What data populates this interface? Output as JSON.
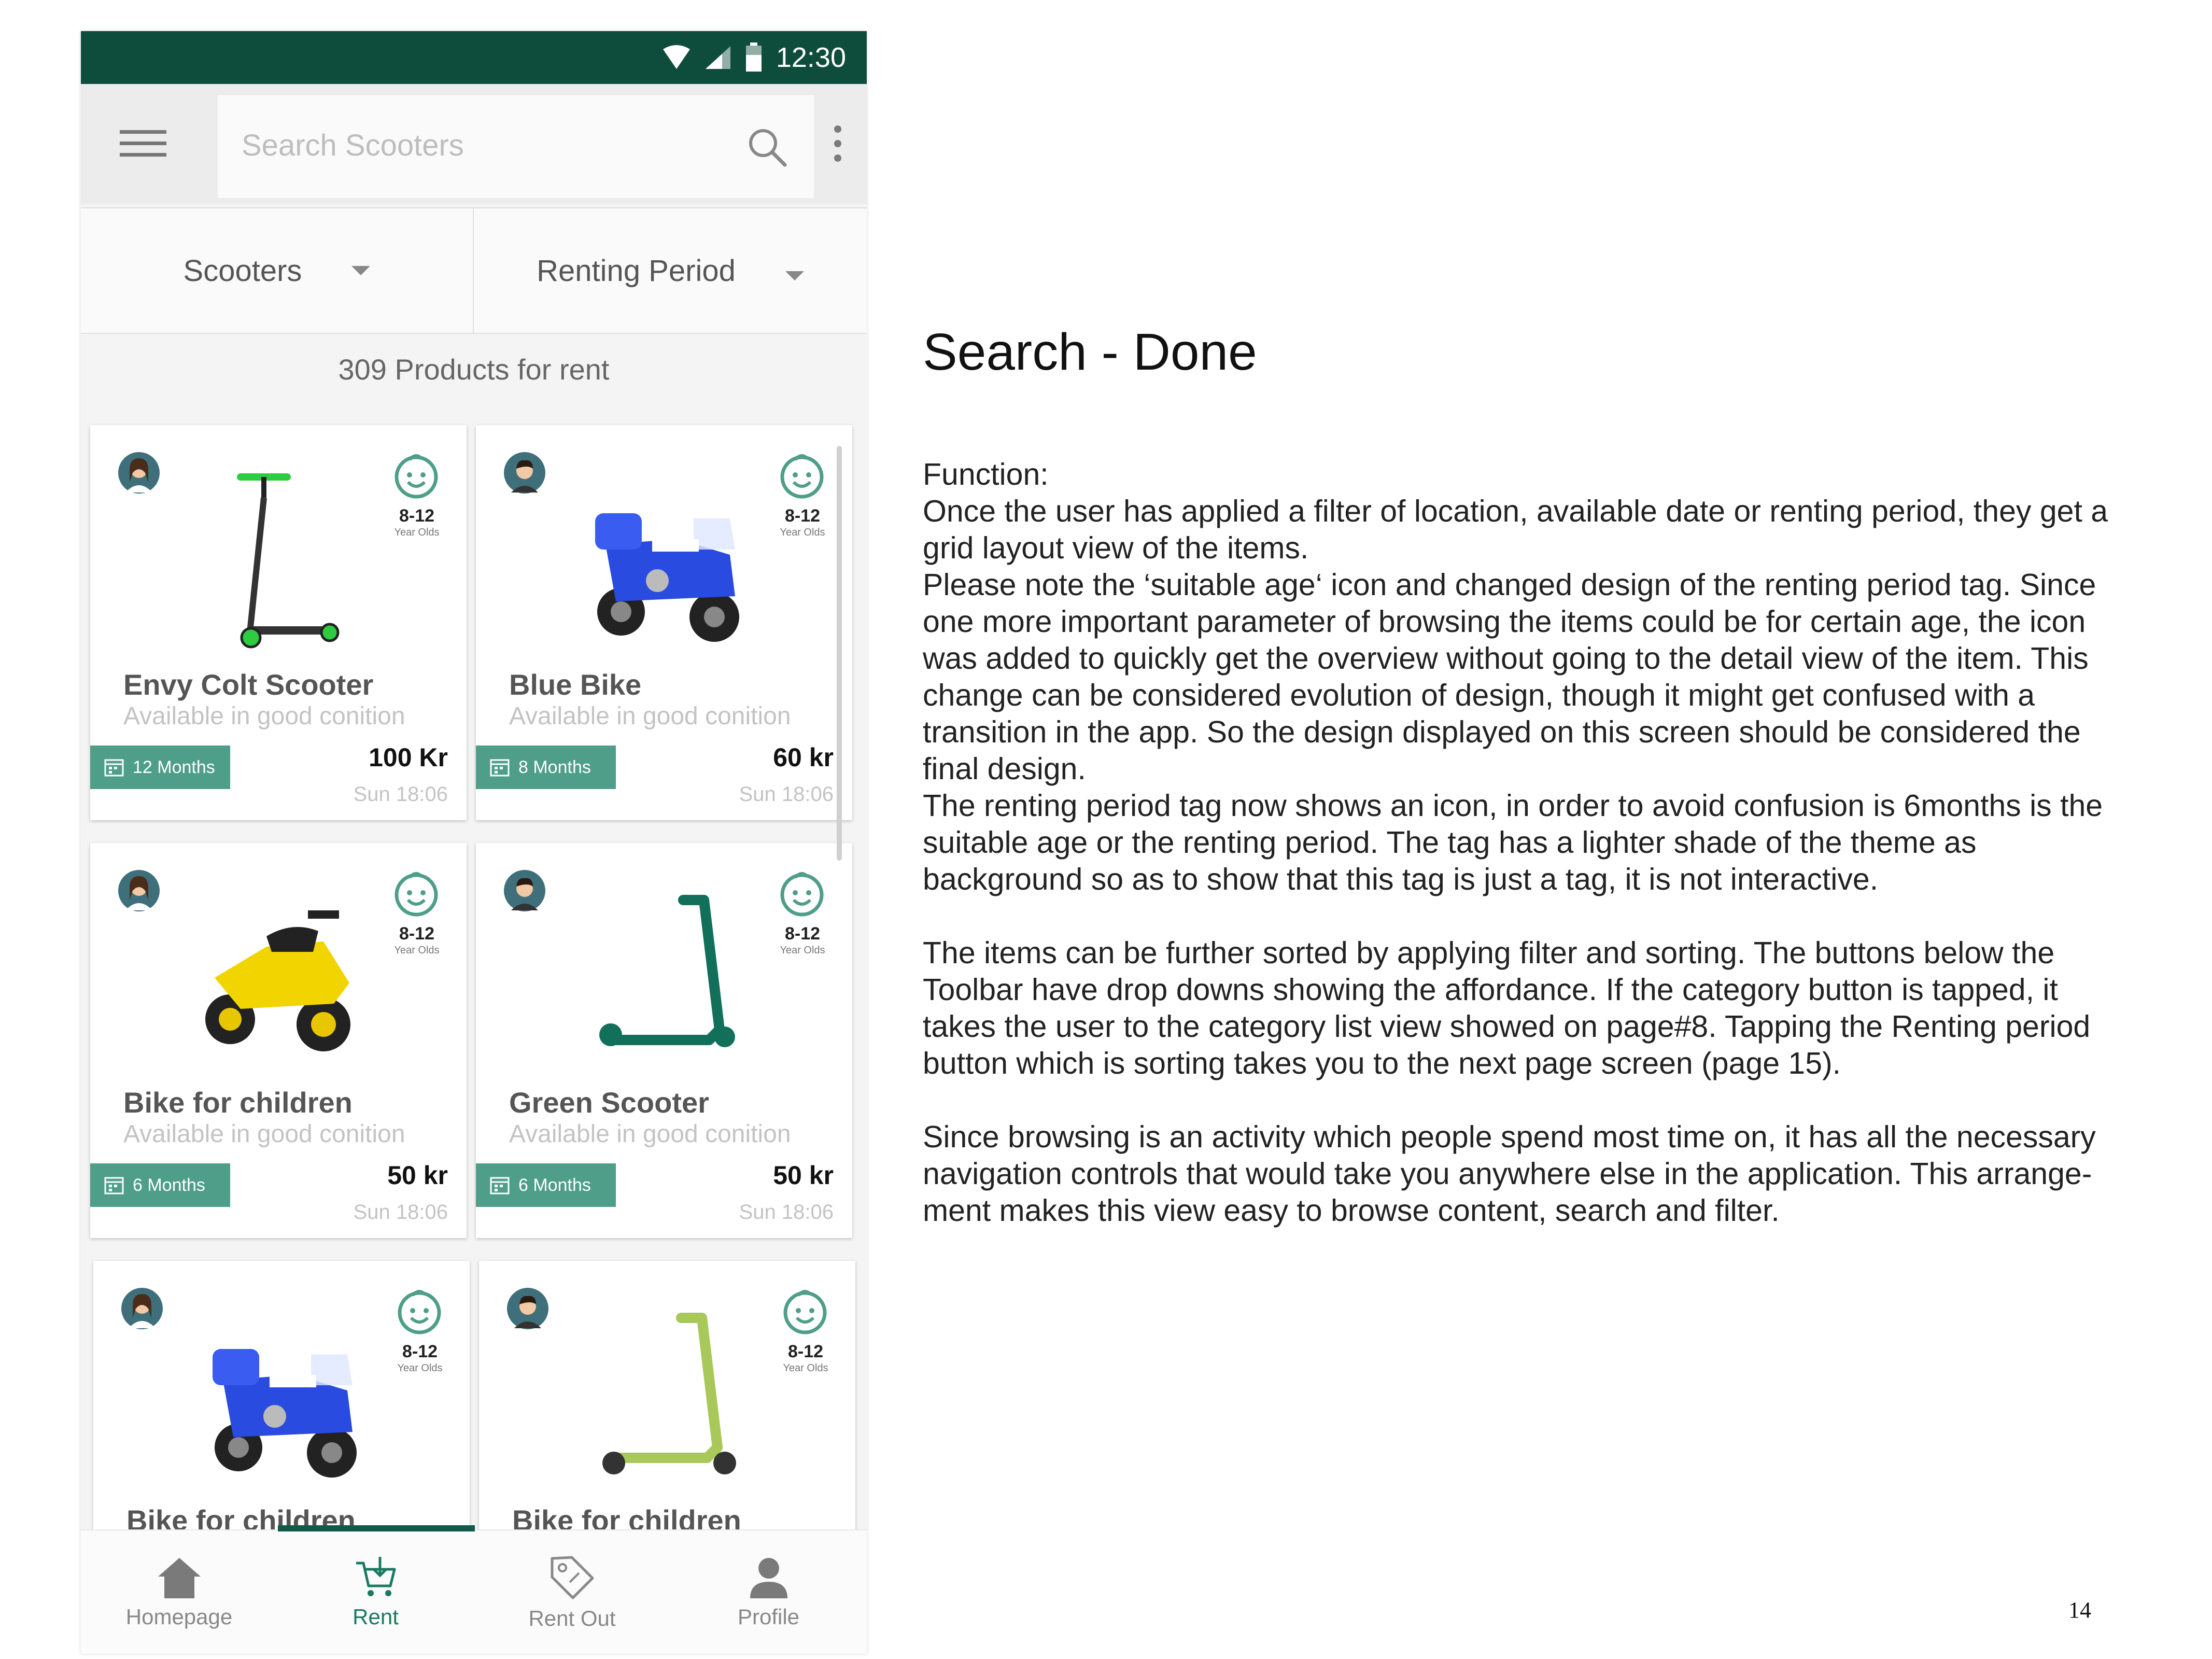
{
  "status_bar": {
    "time": "12:30"
  },
  "toolbar": {
    "search_placeholder": "Search Scooters"
  },
  "filters": {
    "category": "Scooters",
    "period": "Renting Period"
  },
  "products_count": "309 Products for rent",
  "products": [
    {
      "title": "Envy Colt Scooter",
      "subtitle": "Available in good conition",
      "age_range": "8-12",
      "age_unit": "Year Olds",
      "period": "12 Months",
      "price": "100 Kr",
      "time": "Sun 18:06",
      "image": "kick-scooter",
      "avatar": "female-avatar"
    },
    {
      "title": "Blue Bike",
      "subtitle": "Available in good conition",
      "age_range": "8-12",
      "age_unit": "Year Olds",
      "period": "8 Months",
      "price": "60 kr",
      "time": "Sun 18:06",
      "image": "blue-police-bike",
      "avatar": "male-avatar"
    },
    {
      "title": "Bike for children",
      "subtitle": "Available in good conition",
      "age_range": "8-12",
      "age_unit": "Year Olds",
      "period": "6 Months",
      "price": "50 kr",
      "time": "Sun 18:06",
      "image": "yellow-bike",
      "avatar": "female-avatar"
    },
    {
      "title": "Green Scooter",
      "subtitle": "Available in good conition",
      "age_range": "8-12",
      "age_unit": "Year Olds",
      "period": "6 Months",
      "price": "50 kr",
      "time": "Sun 18:06",
      "image": "green-scooter",
      "avatar": "male-avatar"
    },
    {
      "title": "Bike for children",
      "age_range": "8-12",
      "age_unit": "Year Olds",
      "image": "blue-police-bike",
      "avatar": "female-avatar"
    },
    {
      "title": "Bike for children",
      "age_range": "8-12",
      "age_unit": "Year Olds",
      "image": "lime-scooter",
      "avatar": "male-avatar"
    }
  ],
  "bottom_nav": [
    {
      "label": "Homepage",
      "icon": "home-icon"
    },
    {
      "label": "Rent",
      "icon": "cart-icon",
      "active": true
    },
    {
      "label": "Rent Out",
      "icon": "tag-icon"
    },
    {
      "label": "Profile",
      "icon": "person-icon"
    }
  ],
  "colors": {
    "theme_dark": "#0e4d3b",
    "tag_bg": "#4f9e8a",
    "age_icon": "#4f9e8a",
    "active_nav": "#1a7a60"
  },
  "doc": {
    "title": "Search - Done",
    "function_label": "Function:",
    "para1": "Once the user has applied a filter of location, available date or renting period, they get a grid layout view of the items.",
    "para2": "Please note the ‘suitable age‘ icon and changed design of the renting period tag. Since one more important parameter of browsing the items could be for certain age, the icon was added to quickly get the overview without going to the detail view of the item.  This change can be considered evolution of design, though it might get confused with a transition in the app. So the design displayed on this screen should be considered the final design.",
    "para3": "The renting period tag now shows an icon, in order to avoid confusion is 6months is the suitable age or the renting period. The tag has a lighter shade of the theme as background so as to show that this tag is just a tag, it is not interactive.",
    "para4": "The items can be further sorted by applying filter and sorting. The buttons below the Toolbar have drop downs showing the affordance. If the category button is tapped, it takes the user to the category list view showed on page#8. Tapping the Renting period button which is sorting takes you to the next page screen (page 15).",
    "para5": "Since browsing is an activity which people spend most time on, it has all the necessary navigation controls that would take you anywhere else in the application. This arrange-ment makes this view easy to browse content, search and filter.",
    "page_number": "14"
  }
}
